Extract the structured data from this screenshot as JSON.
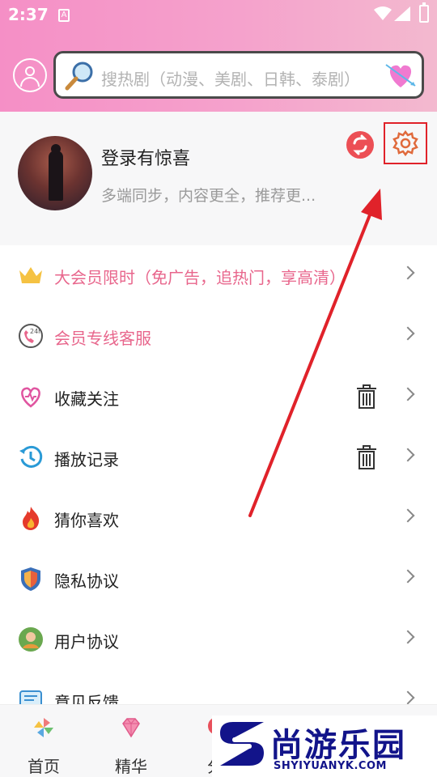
{
  "status_bar": {
    "time": "2:37"
  },
  "search": {
    "placeholder": "搜热剧（动漫、美剧、日韩、泰剧）"
  },
  "profile": {
    "name": "登录有惊喜",
    "description": "多端同步，内容更全，推荐更..."
  },
  "menu": {
    "items": [
      {
        "label": "大会员限时（免广告，追热门，享高清）",
        "icon": "crown-icon",
        "highlight": true,
        "has_delete": false
      },
      {
        "label": "会员专线客服",
        "icon": "24h-service-icon",
        "highlight": true,
        "has_delete": false
      },
      {
        "label": "收藏关注",
        "icon": "heart-outline-icon",
        "highlight": false,
        "has_delete": true
      },
      {
        "label": "播放记录",
        "icon": "history-clock-icon",
        "highlight": false,
        "has_delete": true
      },
      {
        "label": "猜你喜欢",
        "icon": "flame-icon",
        "highlight": false,
        "has_delete": false
      },
      {
        "label": "隐私协议",
        "icon": "shield-icon",
        "highlight": false,
        "has_delete": false
      },
      {
        "label": "用户协议",
        "icon": "user-badge-icon",
        "highlight": false,
        "has_delete": false
      },
      {
        "label": "意见反馈",
        "icon": "feedback-icon",
        "highlight": false,
        "has_delete": false
      }
    ]
  },
  "bottom_nav": {
    "tabs": [
      {
        "label": "首页",
        "icon": "pinwheel-icon"
      },
      {
        "label": "精华",
        "icon": "diamond-icon"
      },
      {
        "label": "分",
        "icon": "category-icon"
      }
    ]
  },
  "watermark": {
    "title": "尚游乐园",
    "subtitle": "SHYIYUANYK.COM"
  },
  "colors": {
    "accent_pink": "#e8668c",
    "header_pink": "#f58fc6",
    "annotation_red": "#e0222a"
  }
}
